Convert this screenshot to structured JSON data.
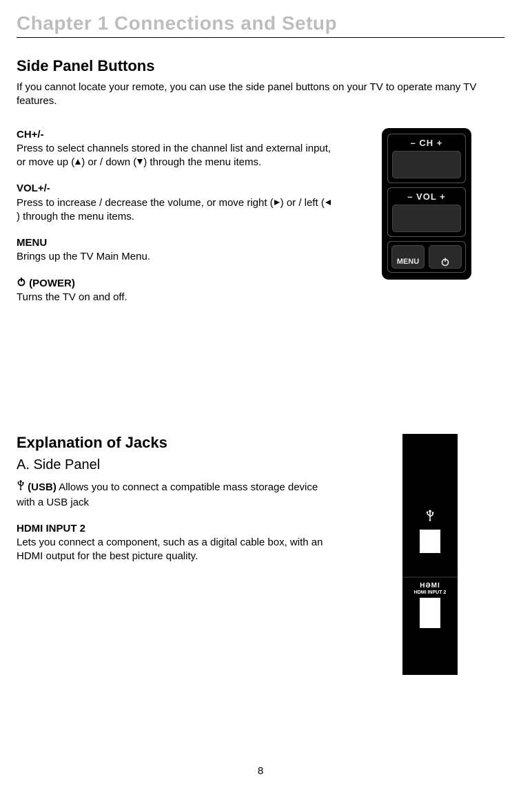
{
  "chapter_title": "Chapter 1 Connections and Setup",
  "section1": {
    "heading": "Side Panel Buttons",
    "intro": "If you cannot locate your remote, you can use the side panel buttons on your TV to operate many TV features.",
    "items": [
      {
        "title": "CH+/-",
        "body_a": "Press to select channels stored in the channel list and external input, or move up (",
        "body_b": ") or / down (",
        "body_c": ") through the menu items."
      },
      {
        "title": "VOL+/-",
        "body_a": "Press to increase / decrease the volume, or move right (",
        "body_b": ") or / left (",
        "body_c": ") through the menu items."
      },
      {
        "title": "MENU",
        "body": "Brings up the TV Main Menu."
      },
      {
        "title": "(POWER)",
        "body": "Turns the TV on and off."
      }
    ],
    "remote_labels": {
      "ch": "–  CH  +",
      "vol": "– VOL +",
      "menu": "MENU"
    }
  },
  "section2": {
    "heading": "Explanation of Jacks",
    "subheading": "A. Side Panel",
    "usb": {
      "title": "(USB)",
      "body": "  Allows you to connect a compatible mass storage device with a USB jack"
    },
    "hdmi": {
      "title": "HDMI INPUT 2",
      "body": "Lets you connect a component, such as a digital cable box, with an HDMI output for the best picture quality."
    },
    "panel_labels": {
      "hdmi_logo": "HƏMI",
      "hdmi_text": "HDMI INPUT 2"
    }
  },
  "page_number": "8"
}
